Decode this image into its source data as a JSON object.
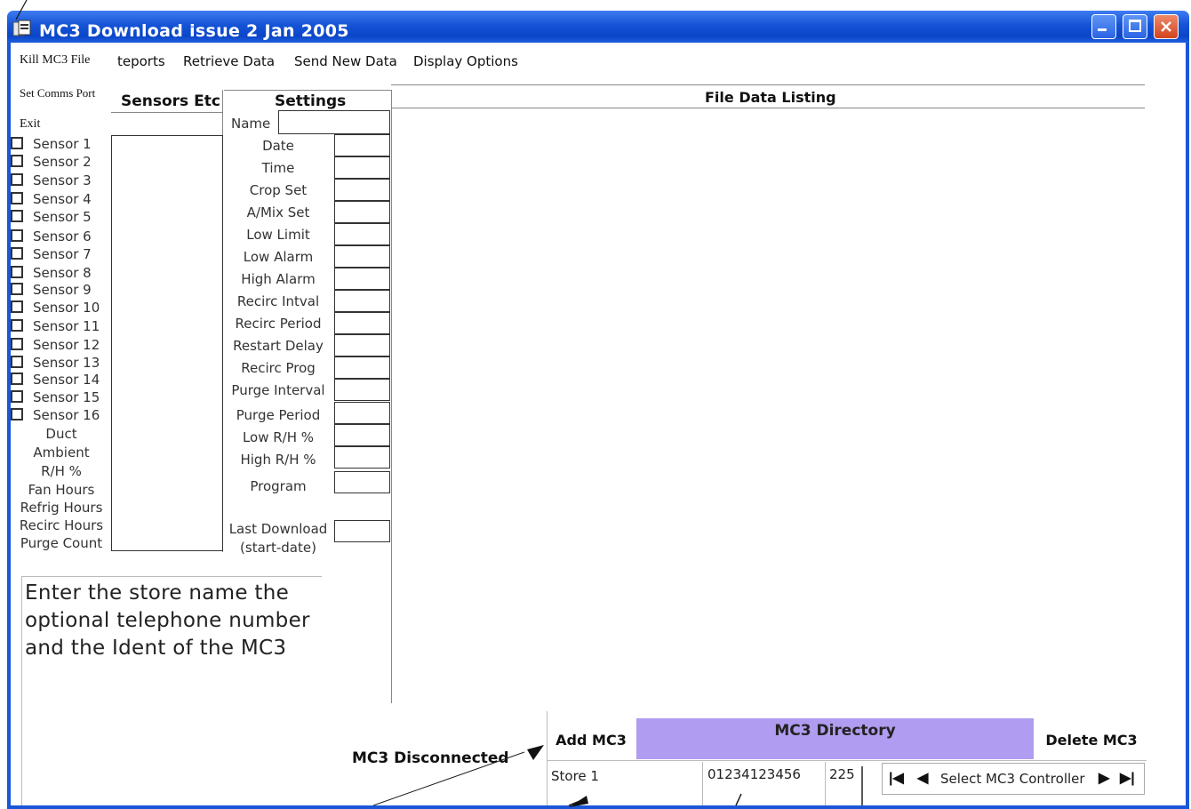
{
  "window": {
    "title": "MC3 Download issue 2 Jan 2005",
    "controls": {
      "minimize": "_",
      "maximize": "□",
      "close": "✕"
    },
    "colors": {
      "titlebar": "#1553d6",
      "close": "#d2431c",
      "directory": "#b09cf0"
    }
  },
  "menu": {
    "kill_file": "Kill MC3 File",
    "reports": "teports",
    "retrieve": "Retrieve Data",
    "send": "Send New Data",
    "display": "Display Options",
    "set_comms": "Set Comms Port",
    "exit": "Exit"
  },
  "sensors_panel": {
    "heading": "Sensors Etc",
    "sensors": [
      "Sensor 1",
      "Sensor 2",
      "Sensor 3",
      "Sensor 4",
      "Sensor 5",
      "Sensor 6",
      "Sensor 7",
      "Sensor 8",
      "Sensor 9",
      "Sensor 10",
      "Sensor 11",
      "Sensor 12",
      "Sensor 13",
      "Sensor 14",
      "Sensor 15",
      "Sensor 16"
    ],
    "extras": [
      "Duct",
      "Ambient",
      "R/H %",
      "Fan Hours",
      "Refrig Hours",
      "Recirc Hours",
      "Purge Count"
    ]
  },
  "settings_panel": {
    "heading": "Settings",
    "name_label": "Name",
    "fields": [
      "Date",
      "Time",
      "Crop Set",
      "A/Mix Set",
      "Low Limit",
      "Low Alarm",
      "High Alarm",
      "Recirc Intval",
      "Recirc Period",
      "Restart Delay",
      "Recirc Prog",
      "Purge Interval",
      "Purge Period",
      "Low R/H %",
      "High R/H %",
      "Program"
    ],
    "last_download": "Last Download",
    "last_download_sub": "(start-date)"
  },
  "file_listing": {
    "heading": "File Data Listing"
  },
  "help_text": "Enter the store name the optional telephone number and the Ident of the MC3",
  "status": "MC3 Disconnected",
  "directory": {
    "add_button": "Add MC3",
    "title": "MC3 Directory",
    "delete_button": "Delete MC3",
    "store_name": "Store 1",
    "telephone": "01234123456",
    "ident": "225",
    "navigator_label": "Select MC3 Controller",
    "nav_first": "|◀",
    "nav_prev": "◀",
    "nav_next": "▶",
    "nav_last": "▶|"
  }
}
